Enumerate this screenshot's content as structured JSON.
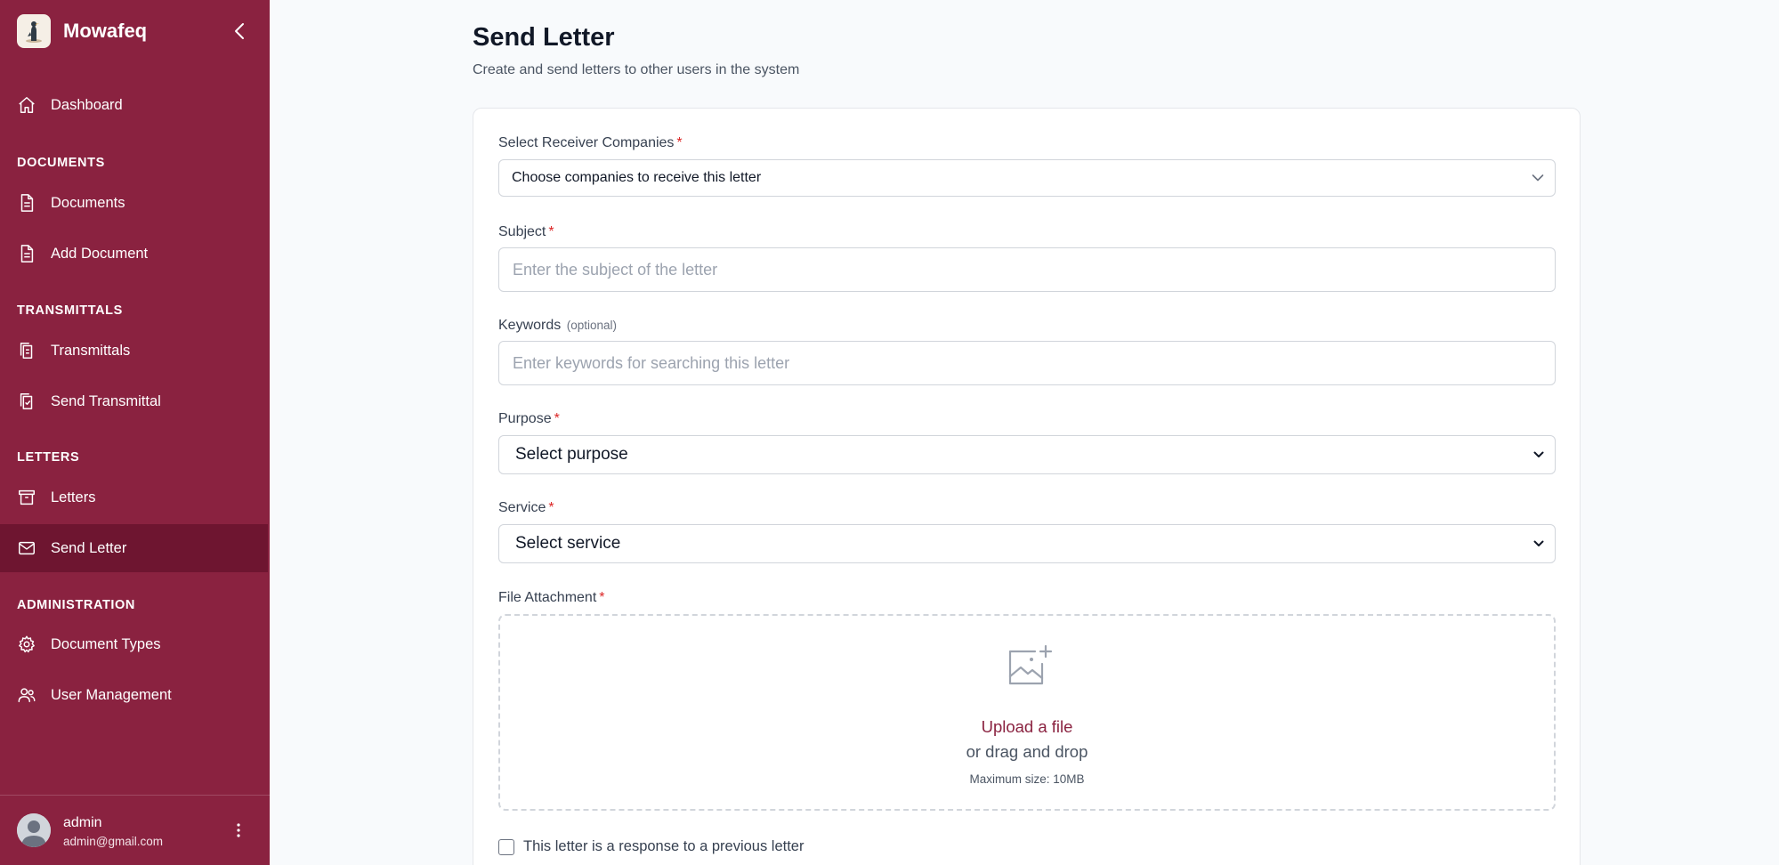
{
  "app": {
    "name": "Mowafeq"
  },
  "sidebar": {
    "dashboard": "Dashboard",
    "sections": {
      "documents": "DOCUMENTS",
      "transmittals": "TRANSMITTALS",
      "letters": "LETTERS",
      "administration": "ADMINISTRATION"
    },
    "items": {
      "documents": "Documents",
      "add_document": "Add Document",
      "transmittals": "Transmittals",
      "send_transmittal": "Send Transmittal",
      "letters": "Letters",
      "send_letter": "Send Letter",
      "document_types": "Document Types",
      "user_management": "User Management"
    },
    "active_item": "Send Letter"
  },
  "user": {
    "name": "admin",
    "email": "admin@gmail.com"
  },
  "page": {
    "title": "Send Letter",
    "subtitle": "Create and send letters to other users in the system"
  },
  "form": {
    "receivers": {
      "label": "Select Receiver Companies",
      "required": "*",
      "value": "Choose companies to receive this letter"
    },
    "subject": {
      "label": "Subject",
      "required": "*",
      "placeholder": "Enter the subject of the letter"
    },
    "keywords": {
      "label": "Keywords",
      "optional": "(optional)",
      "placeholder": "Enter keywords for searching this letter"
    },
    "purpose": {
      "label": "Purpose",
      "required": "*",
      "value": "Select purpose"
    },
    "service": {
      "label": "Service",
      "required": "*",
      "value": "Select service"
    },
    "attachment": {
      "label": "File Attachment",
      "required": "*",
      "upload_link": "Upload a file",
      "drag_text": "or drag and drop",
      "max_size": "Maximum size: 10MB"
    },
    "response_checkbox": {
      "label": "This letter is a response to a previous letter",
      "checked": false
    }
  },
  "colors": {
    "sidebar_bg": "#8a2240",
    "sidebar_active": "#6e1530",
    "accent": "#8a2240",
    "required": "#dc2626"
  }
}
